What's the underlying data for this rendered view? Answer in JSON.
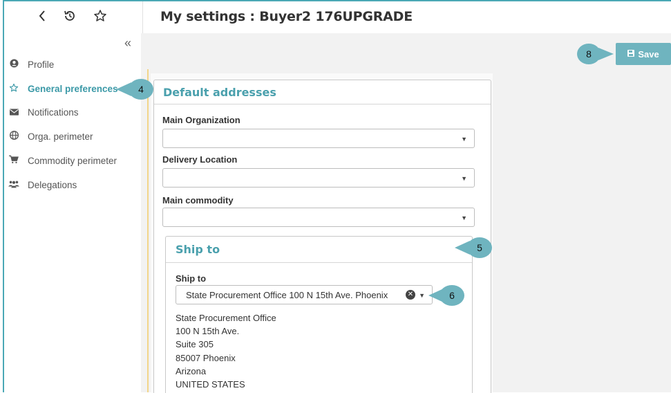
{
  "header": {
    "title": "My settings : Buyer2 176UPGRADE",
    "back_icon": "chevron-left-icon",
    "history_icon": "history-icon",
    "favorite_icon": "star-icon"
  },
  "sidebar": {
    "collapse_icon": "double-chevron-left-icon",
    "items": [
      {
        "label": "Profile",
        "icon": "user-circle-icon"
      },
      {
        "label": "General preferences",
        "icon": "star-icon",
        "active": true
      },
      {
        "label": "Notifications",
        "icon": "envelope-icon"
      },
      {
        "label": "Orga. perimeter",
        "icon": "globe-icon"
      },
      {
        "label": "Commodity perimeter",
        "icon": "cart-icon"
      },
      {
        "label": "Delegations",
        "icon": "users-icon"
      }
    ]
  },
  "toolbar": {
    "save_label": "Save",
    "save_icon": "floppy-disk-icon"
  },
  "callouts": {
    "c4": "4",
    "c5": "5",
    "c6": "6",
    "c8": "8"
  },
  "panel": {
    "title": "Default addresses",
    "main_org_label": "Main Organization",
    "main_org_value": "",
    "delivery_label": "Delivery Location",
    "delivery_value": "",
    "commodity_label": "Main commodity",
    "commodity_value": "",
    "ship_to": {
      "title": "Ship to",
      "field_label": "Ship to",
      "value": "State Procurement Office 100 N 15th Ave. Phoenix",
      "address_lines": [
        "State Procurement Office",
        "100 N 15th Ave.",
        "Suite 305",
        "85007 Phoenix",
        "Arizona",
        "UNITED STATES"
      ]
    }
  },
  "colors": {
    "accent": "#4aa0ad",
    "callout": "#6fb4bf",
    "border": "#4aa8b5"
  }
}
